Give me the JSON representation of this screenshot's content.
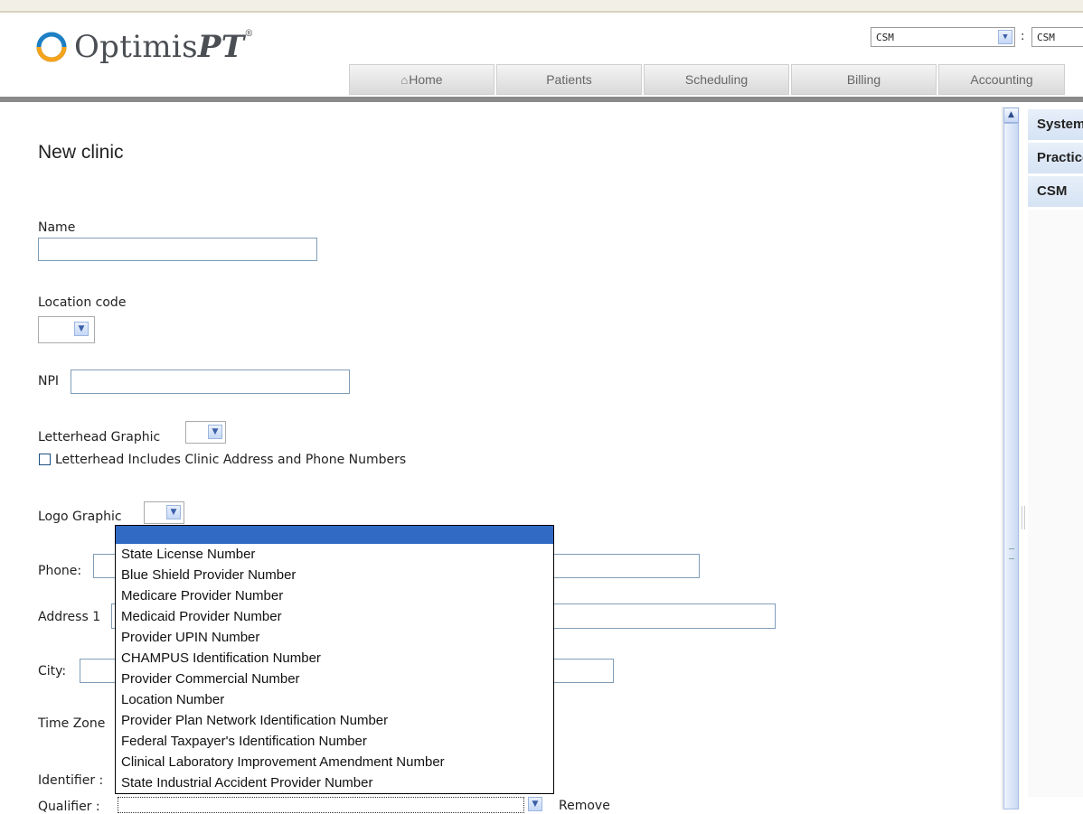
{
  "brand": {
    "logo_main": "Optimis",
    "logo_suffix": "PT",
    "logo_mark": "®"
  },
  "top_selects": [
    {
      "value": "CSM"
    },
    {
      "value": "CSM"
    }
  ],
  "top_separator": ":",
  "nav": {
    "tabs": [
      {
        "label": "Home",
        "icon": "home-icon"
      },
      {
        "label": "Patients"
      },
      {
        "label": "Scheduling"
      },
      {
        "label": "Billing"
      },
      {
        "label": "Accounting"
      }
    ]
  },
  "form": {
    "title": "New clinic",
    "name_label": "Name",
    "name_value": "",
    "location_code_label": "Location code",
    "npi_label": "NPI",
    "letterhead_label": "Letterhead Graphic",
    "letterhead_checkbox_label": "Letterhead Includes Clinic Address and Phone Numbers",
    "logo_label": "Logo Graphic",
    "phone_label": "Phone:",
    "address1_label": "Address 1",
    "city_label": "City:",
    "timezone_label": "Time Zone",
    "identifier_label": "Identifier :",
    "qualifier_label": "Qualifier :",
    "remove_label": "Remove"
  },
  "identifier_dropdown": {
    "options": [
      "State License Number",
      "Blue Shield Provider Number",
      "Medicare Provider Number",
      "Medicaid Provider Number",
      "Provider UPIN Number",
      "CHAMPUS Identification Number",
      "Provider Commercial Number",
      "Location Number",
      "Provider Plan Network Identification Number",
      "Federal Taxpayer's Identification Number",
      "Clinical Laboratory Improvement Amendment Number",
      "State Industrial Accident Provider Number"
    ]
  },
  "right_panel": {
    "items": [
      "System",
      "Practice",
      "CSM"
    ]
  },
  "colors": {
    "selection": "#316ac5",
    "input_border": "#7f9db9",
    "panel": "#dde8f6",
    "logo_orange": "#f5a31a",
    "logo_blue": "#1d7fc4"
  }
}
